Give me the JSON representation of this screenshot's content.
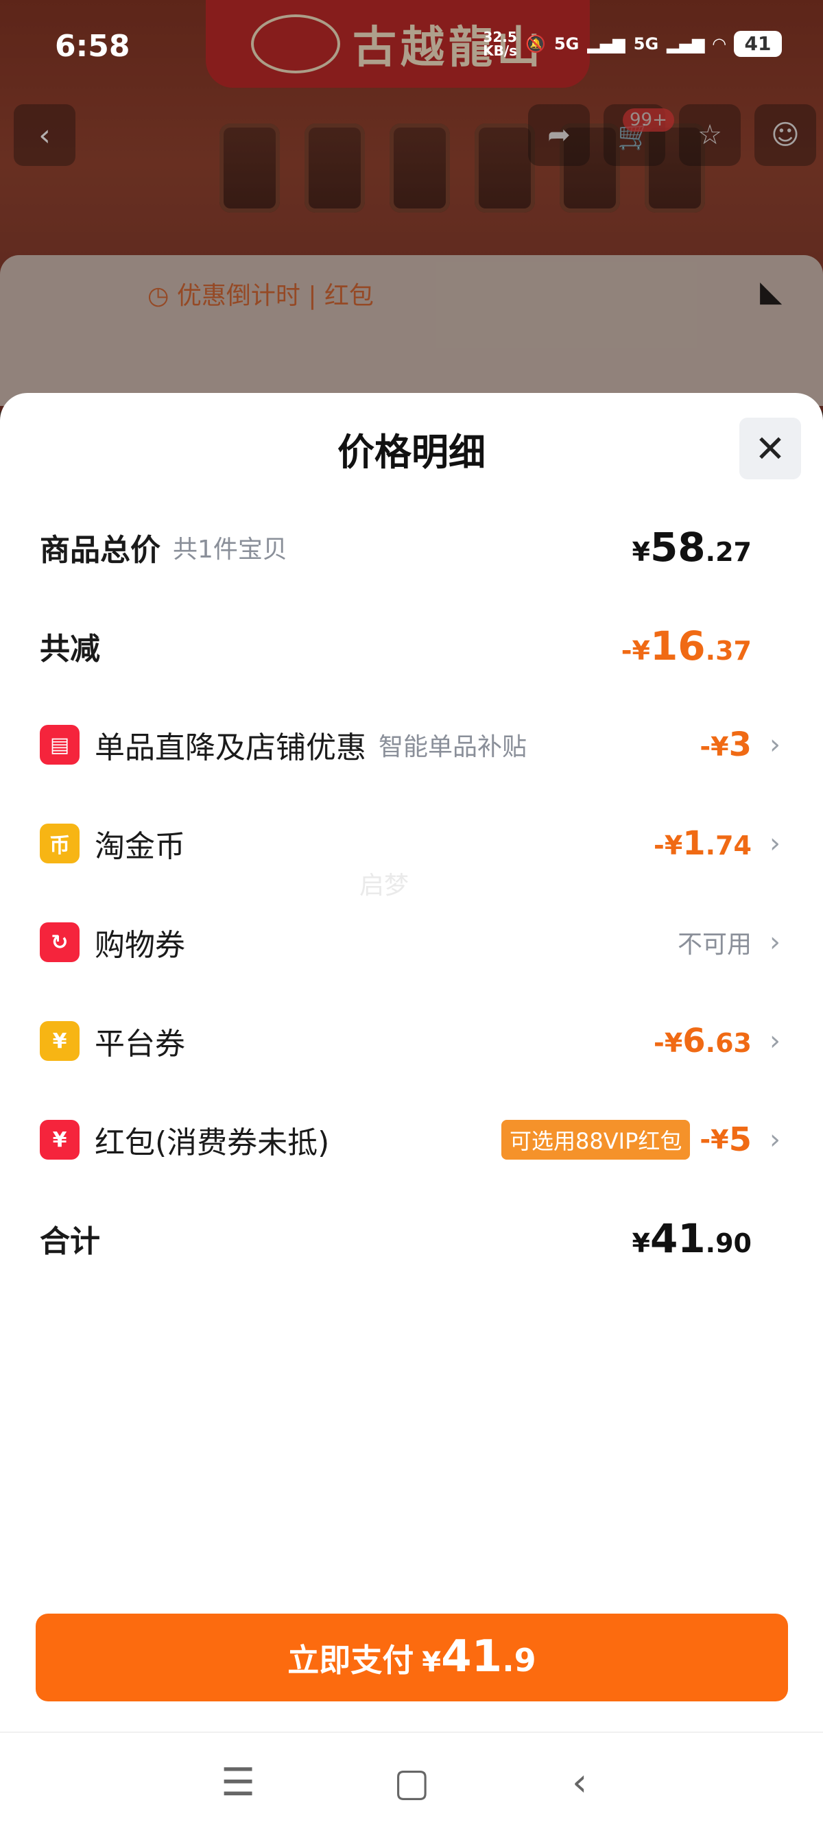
{
  "status_bar": {
    "time": "6:58",
    "net_speed": "32.5",
    "net_speed_unit": "KB/s",
    "signal_1": "5G",
    "signal_2": "5G",
    "battery": "41"
  },
  "background": {
    "brand_name": "古越龍山",
    "cart_badge": "99+",
    "countdown_text": "优惠倒计时 | 红包"
  },
  "sheet": {
    "title": "价格明细",
    "close_icon": "close-icon"
  },
  "rows": {
    "goods_total": {
      "label": "商品总价",
      "sub": "共1件宝贝",
      "symbol": "¥",
      "int": "58",
      "dec": ".27"
    },
    "total_reduction": {
      "label": "共减",
      "symbol": "-¥",
      "int": "16",
      "dec": ".37"
    },
    "store_discount": {
      "label": "单品直降及店铺优惠",
      "sub": "智能单品补贴",
      "symbol": "-¥",
      "int": "3",
      "dec": "",
      "icon": "store-icon"
    },
    "tao_coin": {
      "label": "淘金币",
      "symbol": "-¥",
      "int": "1",
      "dec": ".74",
      "icon": "coin-icon"
    },
    "shopping_coupon": {
      "label": "购物券",
      "status": "不可用",
      "icon": "coupon-icon"
    },
    "platform_coupon": {
      "label": "平台券",
      "symbol": "-¥",
      "int": "6",
      "dec": ".63",
      "icon": "ticket-icon"
    },
    "red_packet": {
      "label": "红包(消费券未抵)",
      "tag": "可选用88VIP红包",
      "symbol": "-¥",
      "int": "5",
      "dec": "",
      "icon": "red-packet-icon"
    },
    "grand_total": {
      "label": "合计",
      "symbol": "¥",
      "int": "41",
      "dec": ".90"
    }
  },
  "watermark": "启梦",
  "pay_button": {
    "label": "立即支付",
    "symbol": "¥",
    "int": "41",
    "dec": ".9"
  },
  "colors": {
    "accent": "#fc6b0f",
    "discount": "#f06a14",
    "icon_red": "#f5243c",
    "icon_yellow": "#f7b514"
  }
}
